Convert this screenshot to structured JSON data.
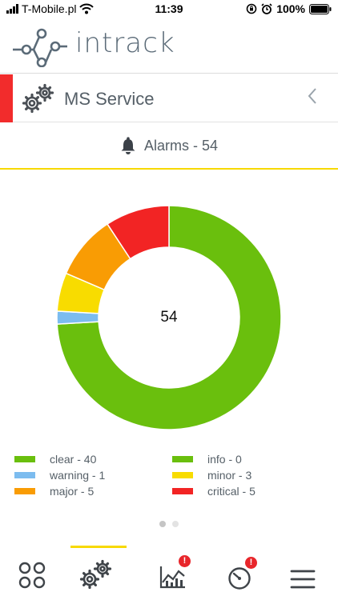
{
  "status_bar": {
    "carrier": "T-Mobile.pl",
    "time": "11:39",
    "battery": "100%",
    "icons": [
      "signal-icon",
      "wifi-icon",
      "screen-lock-icon",
      "alarm-clock-icon",
      "battery-icon"
    ]
  },
  "header": {
    "app_name": "intrack",
    "logo_icon": "network-logo-icon"
  },
  "service": {
    "name": "MS Service",
    "accent_color": "#f22c2c",
    "icon": "gears-icon",
    "back_icon": "chevron-left-icon"
  },
  "alarms": {
    "label": "Alarms - 54",
    "icon": "bell-icon",
    "underline_color": "#f7d900"
  },
  "chart_data": {
    "type": "pie",
    "total": "54",
    "slices": [
      {
        "name": "clear",
        "value": 40,
        "color": "#6abf0d"
      },
      {
        "name": "info",
        "value": 0,
        "color": "#6abf0d"
      },
      {
        "name": "warning",
        "value": 1,
        "color": "#7cbcef"
      },
      {
        "name": "minor",
        "value": 3,
        "color": "#f8dc00"
      },
      {
        "name": "major",
        "value": 5,
        "color": "#f99c04"
      },
      {
        "name": "critical",
        "value": 5,
        "color": "#f22424"
      }
    ],
    "legend": [
      {
        "label": "clear - 40",
        "color": "#6abf0d"
      },
      {
        "label": "info - 0",
        "color": "#6abf0d"
      },
      {
        "label": "warning - 1",
        "color": "#7cbcef"
      },
      {
        "label": "minor - 3",
        "color": "#f8dc00"
      },
      {
        "label": "major - 5",
        "color": "#f99c04"
      },
      {
        "label": "critical - 5",
        "color": "#f22424"
      }
    ],
    "legend_placement": "bottom"
  },
  "pager": {
    "pages": 2,
    "active": 1
  },
  "tabbar": {
    "tabs": [
      {
        "icon": "dashboard-grid-icon",
        "active": false,
        "badge": ""
      },
      {
        "icon": "gears-icon",
        "active": true,
        "badge": ""
      },
      {
        "icon": "chart-icon",
        "active": false,
        "badge": "!"
      },
      {
        "icon": "speedometer-icon",
        "active": false,
        "badge": "!"
      },
      {
        "icon": "menu-icon",
        "active": false,
        "badge": ""
      }
    ],
    "active_color": "#f7d900",
    "badge_color": "#e8262b"
  }
}
